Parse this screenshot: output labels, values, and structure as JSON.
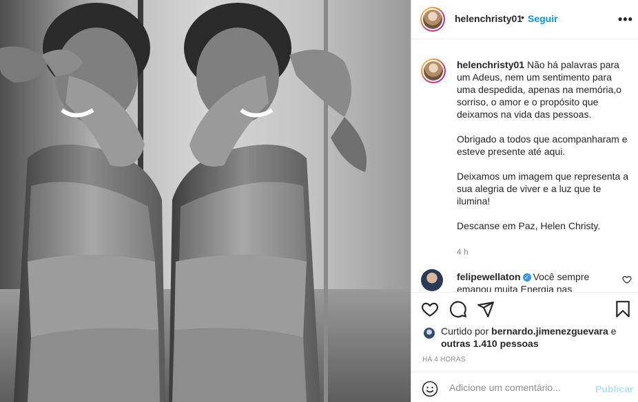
{
  "post": {
    "username": "helenchristy01",
    "follow_label": "Seguir",
    "separator": "•",
    "more_label": "•••"
  },
  "caption": {
    "username": "helenchristy01",
    "line1": "Não há palavras para um Adeus, nem um sentimento para uma despedida, apenas na memória,o sorriso, o amor e o propósito que deixamos na vida das pessoas.",
    "line2": "Obrigado a todos que acompanharam e esteve presente até aqui.",
    "line3": "Deixamos um imagem que representa a sua alegria de viver e a luz que te ilumina!",
    "line4": "Descanse em Paz, Helen Christy.",
    "time": "4 h"
  },
  "reply": {
    "username": "felipewellaton",
    "verified_glyph": "✓",
    "text": "Você sempre emanou muita Energia nas"
  },
  "likes": {
    "prefix": "Curtido por",
    "user": "bernardo.jimenezguevara",
    "and": "e",
    "others": "outras 1.410 pessoas"
  },
  "timestamp": "HÁ 4 HORAS",
  "comment_box": {
    "placeholder": "Adicione um comentário...",
    "post_label": "Publicar"
  },
  "icons": {
    "like": "heart-icon",
    "comment": "comment-icon",
    "share": "share-icon",
    "save": "bookmark-icon",
    "emoji": "emoji-icon",
    "more": "more-icon",
    "verified": "verified-badge-icon"
  },
  "colors": {
    "accent": "#0095f6",
    "muted": "#8e8e8e",
    "publish_disabled": "#b2dffc",
    "verified": "#3897f0"
  }
}
